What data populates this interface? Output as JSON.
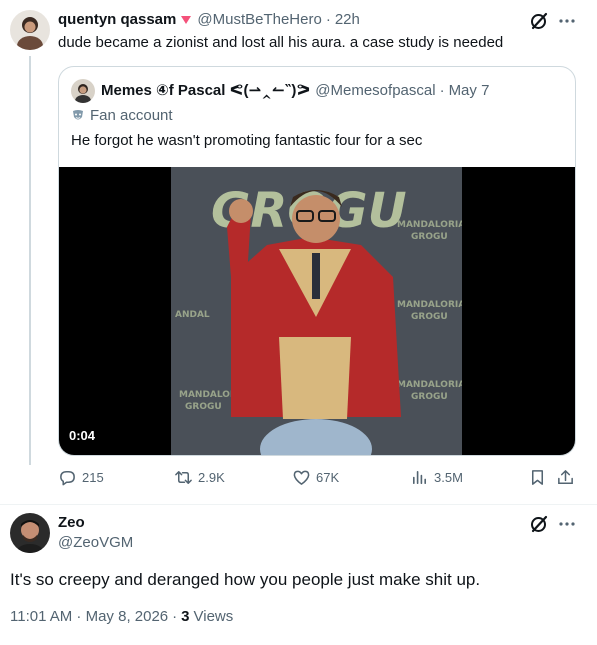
{
  "tweet": {
    "author_name": "quentyn qassam",
    "author_handle": "@MustBeTheHero",
    "separator": "·",
    "time_ago": "22h",
    "text": "dude became a zionist and lost all his aura. a case study is needed",
    "quote": {
      "author_name": "Memes ④f Pascal ᕙ(⇀‸↼‶)ᕗ",
      "author_handle": "@Memesofpascal",
      "separator": "·",
      "date": "May 7",
      "badge_label": "Fan account",
      "text": "He forgot he wasn't promoting fantastic four for a sec",
      "video_time": "0:04"
    },
    "actions": {
      "replies": "215",
      "reposts": "2.9K",
      "likes": "67K",
      "views": "3.5M"
    }
  },
  "reply": {
    "author_name": "Zeo",
    "author_handle": "@ZeoVGM",
    "text": "It's so creepy and deranged how you people just make shit up.",
    "timestamp": "11:01 AM · May 8, 2026",
    "dot": "·",
    "views_count": "3",
    "views_label": "Views"
  },
  "colors": {
    "accent_pink": "#f4517a",
    "text_primary": "#0f1419",
    "text_muted": "#536471",
    "border": "#cfd9de"
  }
}
